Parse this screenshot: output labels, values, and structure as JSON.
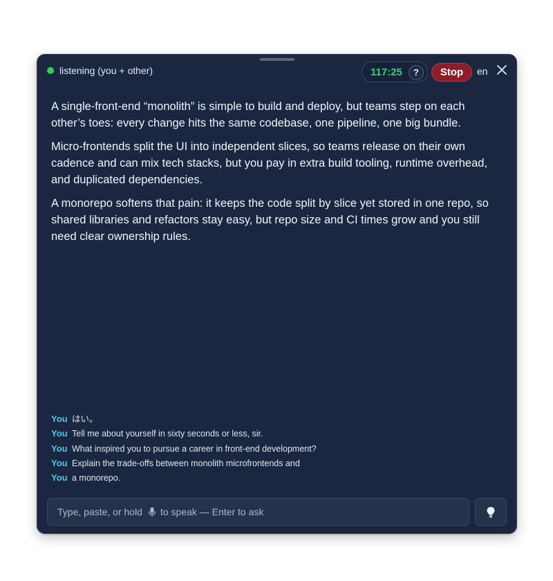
{
  "header": {
    "status_label": "listening (you + other)",
    "timer": "117:25",
    "help_label": "?",
    "stop_label": "Stop",
    "language": "en",
    "status_color": "#2fd14f",
    "timer_color": "#34d26e",
    "stop_color": "#8c1d2a"
  },
  "answer": {
    "paragraphs": [
      "A single-front-end “monolith” is simple to build and deploy, but teams step on each other’s toes: every change hits the same codebase, one pipeline, one big bundle.",
      "Micro-frontends split the UI into independent slices, so teams release on their own cadence and can mix tech stacks, but you pay in extra build tooling, runtime overhead, and duplicated dependencies.",
      "A monorepo softens that pain: it keeps the code split by slice yet stored in one repo, so shared libraries and refactors stay easy, but repo size and CI times grow and you still need clear ownership rules."
    ]
  },
  "transcript": {
    "speaker_color": "#4cc6e8",
    "lines": [
      {
        "speaker": "You",
        "text": "はい。"
      },
      {
        "speaker": "You",
        "text": "Tell me about yourself in sixty seconds or less, sir."
      },
      {
        "speaker": "You",
        "text": "What inspired you to pursue a career in front-end development?"
      },
      {
        "speaker": "You",
        "text": "Explain the trade-offs between monolith microfrontends and"
      },
      {
        "speaker": "You",
        "text": "a monorepo."
      }
    ]
  },
  "input": {
    "placeholder_before": "Type, paste, or hold",
    "placeholder_after": "to speak — Enter to ask",
    "mic_icon": "microphone-icon"
  },
  "hint_button": {
    "icon": "lightbulb-icon"
  },
  "colors": {
    "window_bg": "#1b2740",
    "input_bg": "#24324c"
  }
}
